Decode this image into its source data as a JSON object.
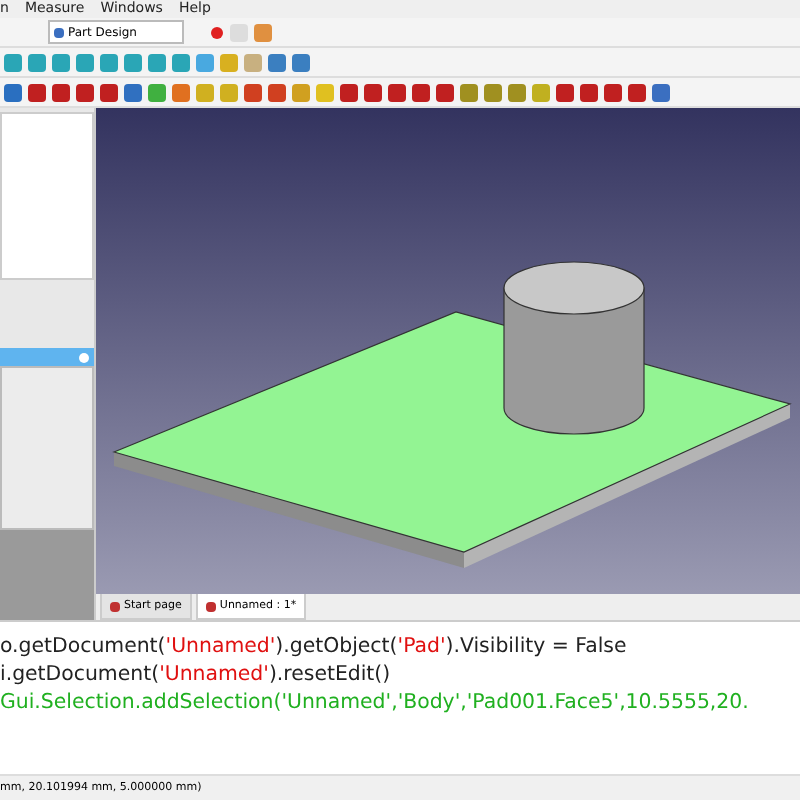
{
  "menu_bar": [
    "n",
    "Measure",
    "Windows",
    "Help"
  ],
  "workbench_selector": {
    "value": "Part Design"
  },
  "document_tabs": [
    {
      "label": "Start page",
      "selected": false
    },
    {
      "label": "Unnamed : 1*",
      "selected": true
    }
  ],
  "python_console": [
    [
      {
        "kind": "code",
        "text": "o.getDocument("
      },
      {
        "kind": "string",
        "text": "'Unnamed'"
      },
      {
        "kind": "code",
        "text": ").getObject("
      },
      {
        "kind": "string",
        "text": "'Pad'"
      },
      {
        "kind": "code",
        "text": ").Visibility = False"
      }
    ],
    [
      {
        "kind": "code",
        "text": "i.getDocument("
      },
      {
        "kind": "string",
        "text": "'Unnamed'"
      },
      {
        "kind": "code",
        "text": ").resetEdit()"
      }
    ],
    [
      {
        "kind": "comment",
        "text": "Gui.Selection.addSelection('Unnamed','Body','Pad001.Face5',10.5555,20."
      }
    ]
  ],
  "status_bar": "mm, 20.101994 mm, 5.000000 mm)"
}
